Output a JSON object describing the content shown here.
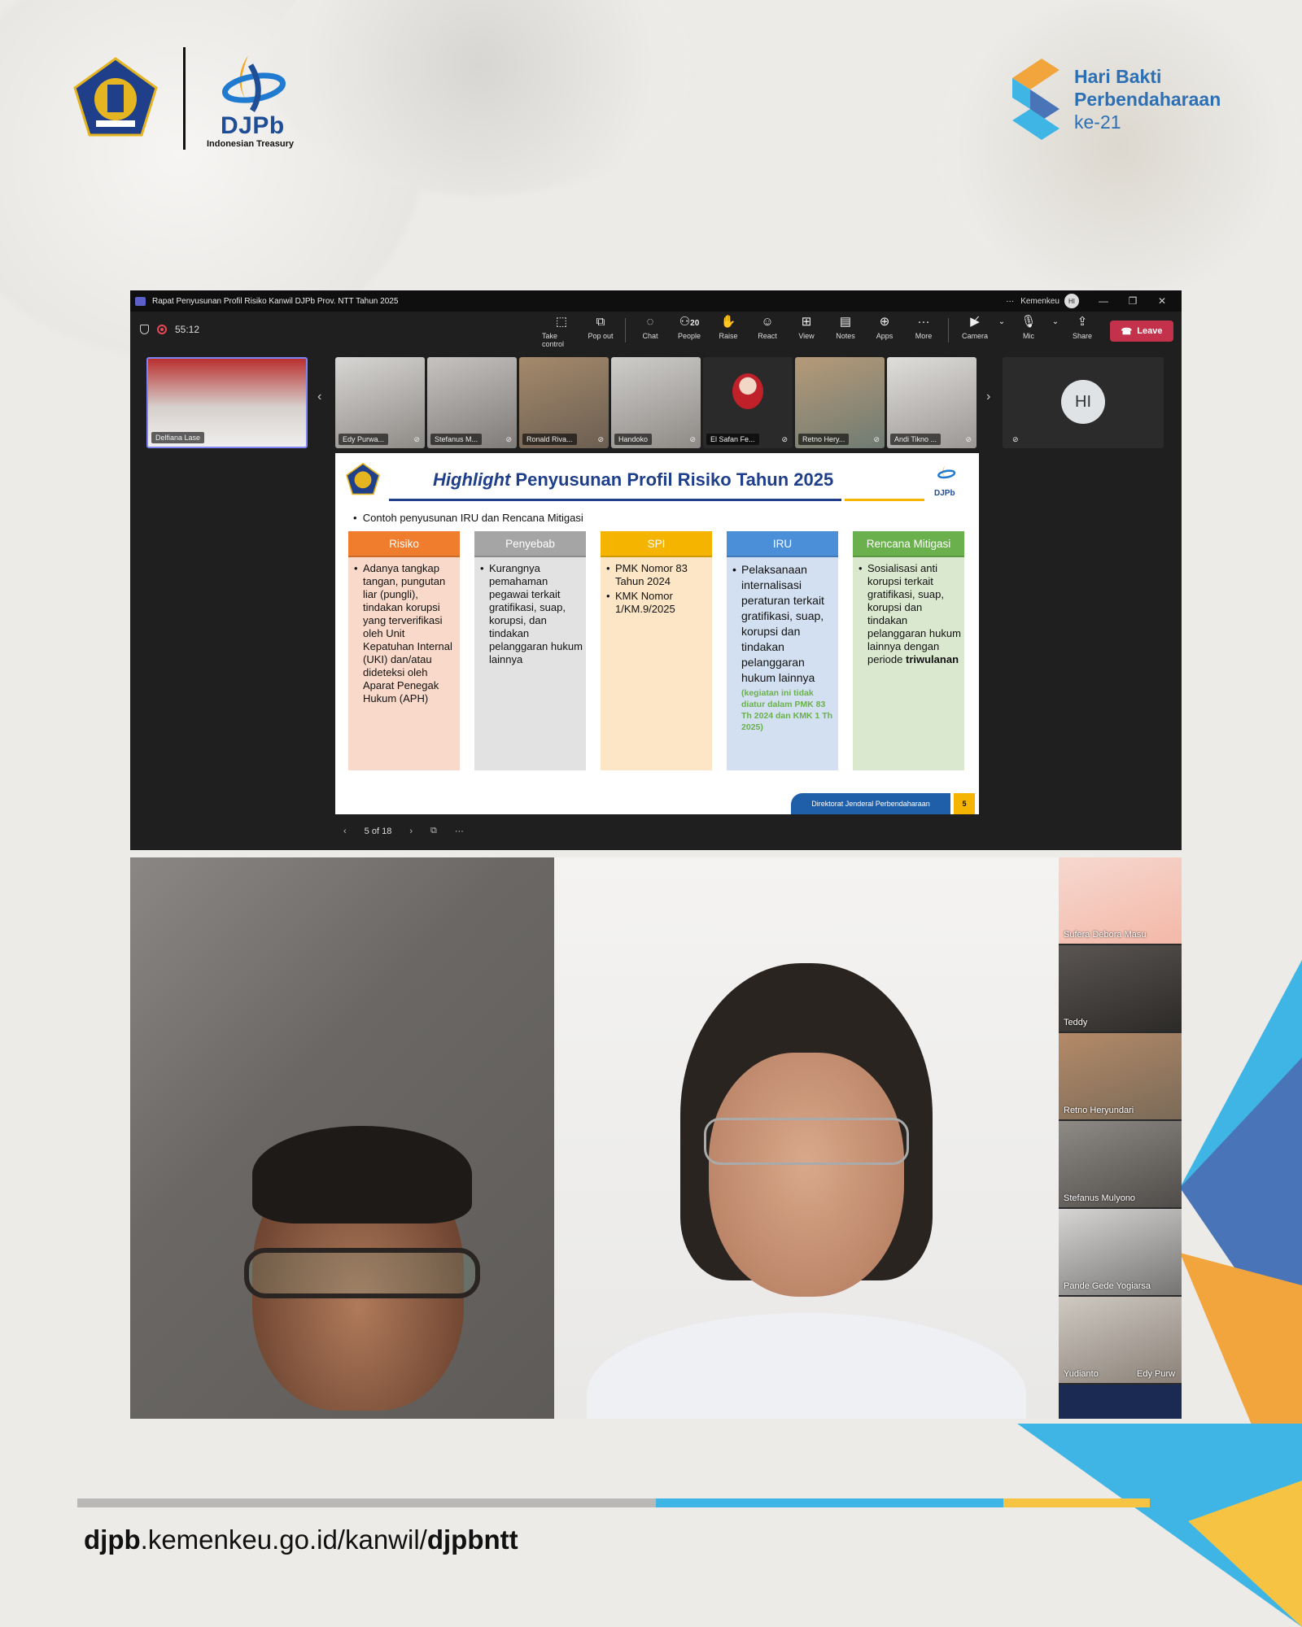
{
  "header": {
    "djpb_logo_text": "DJPb",
    "djpb_logo_sub": "Indonesian Treasury",
    "event_line1": "Hari Bakti",
    "event_line2": "Perbendaharaan",
    "event_line3": "ke-21"
  },
  "teams": {
    "window_title": "Rapat Penyusunan Profil Risiko Kanwil DJPb Prov. NTT Tahun 2025",
    "org": "Kemenkeu",
    "user_initials": "HI",
    "timer": "55:12",
    "toolbar": {
      "take_control": "Take control",
      "pop_out": "Pop out",
      "chat": "Chat",
      "people": "People",
      "people_count": "20",
      "raise": "Raise",
      "react": "React",
      "view": "View",
      "notes": "Notes",
      "apps": "Apps",
      "more": "More",
      "camera": "Camera",
      "mic": "Mic",
      "share": "Share",
      "leave": "Leave"
    },
    "participants": [
      "Delfiana Lase",
      "Edy Purwa...",
      "Stefanus M...",
      "Ronald Riva...",
      "Handoko",
      "El Safan Fe...",
      "Retno Hery...",
      "Andi Tikno ..."
    ],
    "extra_avatar": "HI",
    "slide_nav": {
      "page": "5 of 18",
      "more": "···"
    }
  },
  "slide": {
    "title_italic": "Highlight",
    "title_rest": " Penyusunan Profil Risiko Tahun 2025",
    "logo_text": "DJPb",
    "bullet": "Contoh penyusunan IRU dan Rencana Mitigasi",
    "columns": [
      {
        "header": "Risiko",
        "items": [
          "Adanya tangkap tangan, pungutan liar (pungli), tindakan korupsi yang terverifikasi oleh Unit Kepatuhan Internal (UKI) dan/atau dideteksi oleh Aparat Penegak Hukum (APH)"
        ]
      },
      {
        "header": "Penyebab",
        "items": [
          "Kurangnya pemahaman pegawai terkait gratifikasi, suap, korupsi, dan tindakan pelanggaran hukum lainnya"
        ]
      },
      {
        "header": "SPI",
        "items": [
          "PMK Nomor 83 Tahun 2024",
          "KMK Nomor 1/KM.9/2025"
        ]
      },
      {
        "header": "IRU",
        "items": [
          "Pelaksanaan internalisasi peraturan terkait gratifikasi, suap, korupsi dan tindakan pelanggaran hukum lainnya"
        ],
        "note": "(kegiatan ini tidak diatur dalam PMK 83 Th 2024 dan KMK 1 Th 2025)"
      },
      {
        "header": "Rencana Mitigasi",
        "items": [
          "Sosialisasi anti korupsi terkait gratifikasi, suap, korupsi dan tindakan pelanggaran hukum lainnya dengan periode"
        ],
        "bold_tail": "triwulanan"
      }
    ],
    "footer": "Direktorat Jenderal Perbendaharaan",
    "page_number": "5"
  },
  "video": {
    "sidebar_names": [
      "Sufera Debora Masu",
      "Teddy",
      "Retno Heryundari",
      "Stefanus Mulyono",
      "Pande Gede Yogiarsa",
      "Yudianto",
      "Edy Purw"
    ]
  },
  "footer": {
    "url_bold1": "djpb",
    "url_mid": ".kemenkeu.go.id/kanwil/",
    "url_bold2": "djpbntt"
  },
  "colors": {
    "risiko": "#ef7d2d",
    "penyebab": "#a5a5a5",
    "spi": "#f5b400",
    "iru": "#4a8fd8",
    "mitigasi": "#6ab04c",
    "brand_blue": "#1f4e97",
    "leave_red": "#c4314b"
  }
}
